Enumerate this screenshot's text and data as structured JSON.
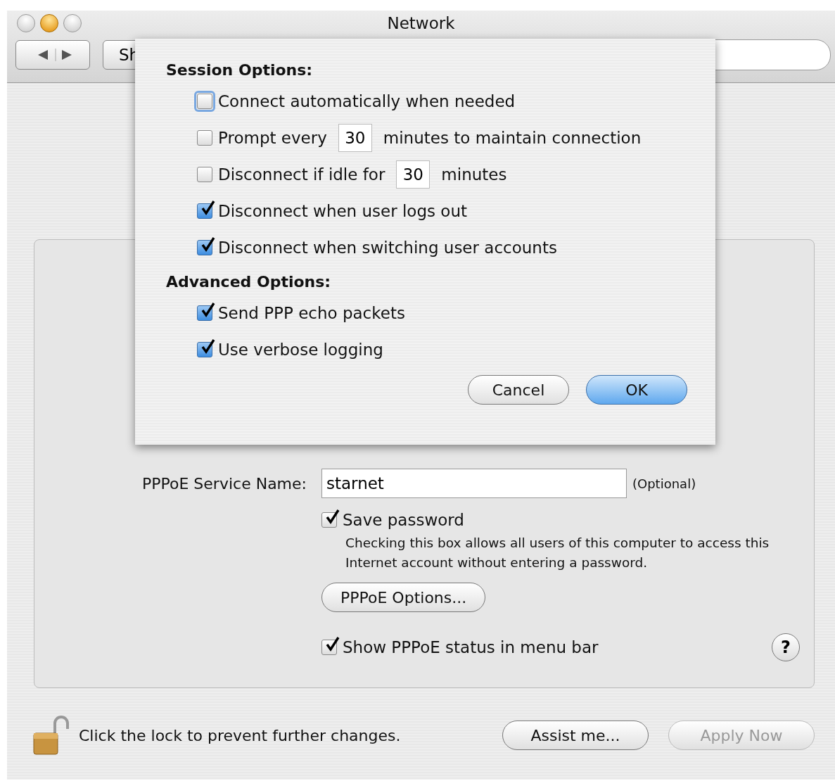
{
  "window": {
    "title": "Network"
  },
  "toolbar": {
    "show_all_button": "Sh"
  },
  "sheet": {
    "sections": [
      {
        "heading": "Session Options:",
        "options": [
          {
            "kind": "checkbox",
            "label": "Connect automatically when needed",
            "checked": false,
            "focused": true
          },
          {
            "kind": "number",
            "label": "Prompt every",
            "value": "30",
            "suffix": "minutes to maintain connection",
            "checked": false
          },
          {
            "kind": "number",
            "label": "Disconnect if idle for",
            "value": "30",
            "suffix": "minutes",
            "checked": false
          },
          {
            "kind": "checkbox",
            "label": "Disconnect when user logs out",
            "checked": true
          },
          {
            "kind": "checkbox",
            "label": "Disconnect when switching user accounts",
            "checked": true
          }
        ]
      },
      {
        "heading": "Advanced Options:",
        "options": [
          {
            "kind": "checkbox",
            "label": "Send PPP echo packets",
            "checked": true
          },
          {
            "kind": "checkbox",
            "label": "Use verbose logging",
            "checked": true
          }
        ]
      }
    ],
    "buttons": [
      {
        "label": "Cancel",
        "default": false
      },
      {
        "label": "OK",
        "default": true
      }
    ]
  },
  "panel": {
    "service_name": {
      "label": "PPPoE Service Name:",
      "value": "starnet",
      "hint": "(Optional)"
    },
    "save_password": {
      "label": "Save password",
      "checked": true,
      "note": "Checking this box allows all users of this computer to access this Internet account without entering a password."
    },
    "options_button": "PPPoE Options...",
    "status": {
      "label": "Show PPPoE status in menu bar",
      "checked": true
    },
    "help": "?"
  },
  "footer": {
    "lock_text": "Click the lock to prevent further changes.",
    "buttons": [
      {
        "label": "Assist me...",
        "disabled": false
      },
      {
        "label": "Apply Now",
        "disabled": true
      }
    ]
  }
}
